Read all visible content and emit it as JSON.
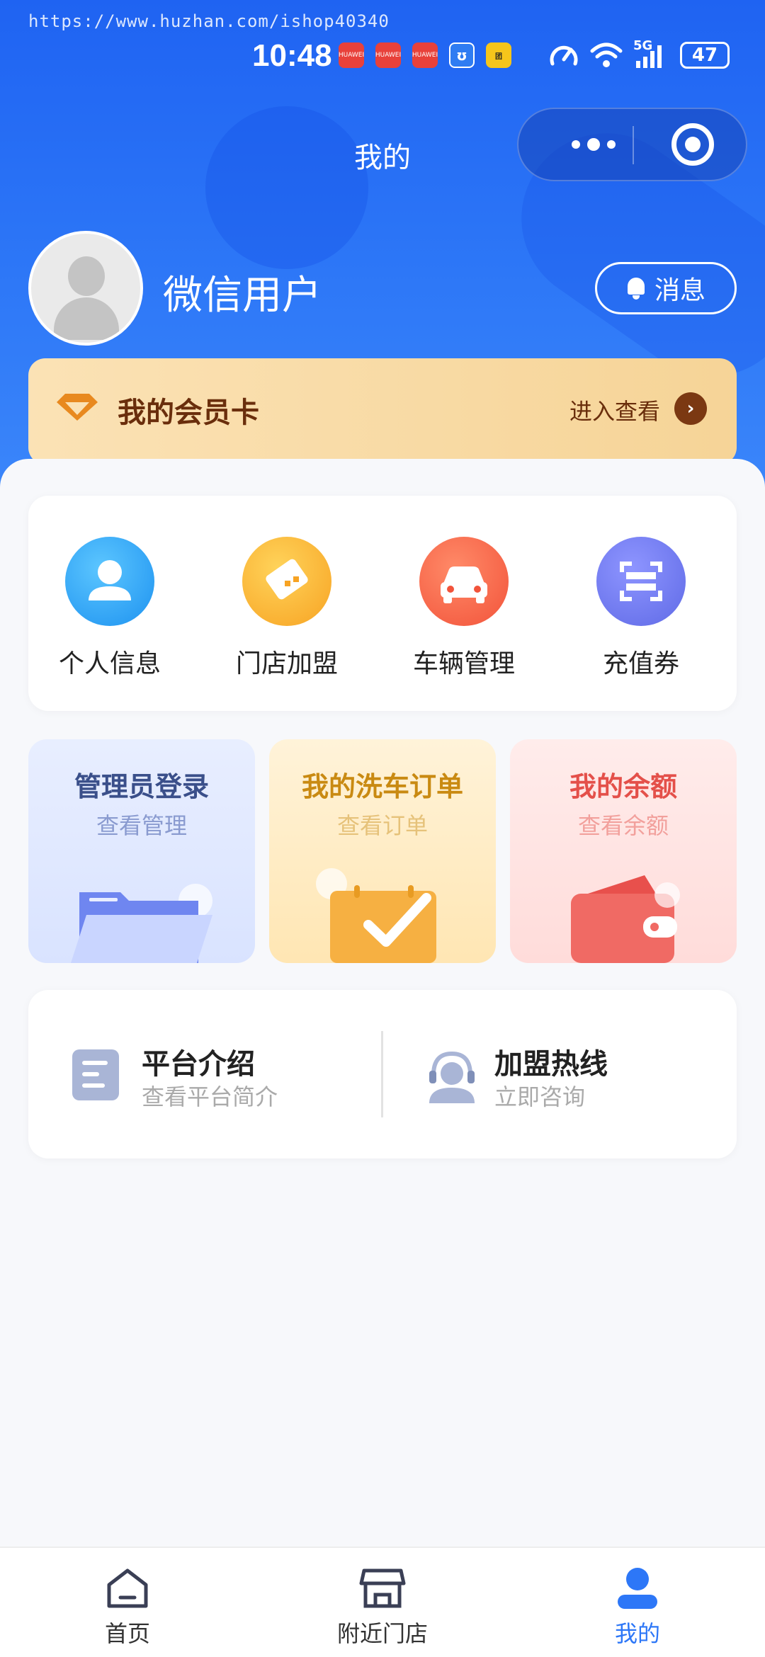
{
  "watermark": "https://www.huzhan.com/ishop40340",
  "status_bar": {
    "time": "10:48",
    "network": "5G",
    "battery": "47"
  },
  "nav": {
    "title": "我的"
  },
  "profile": {
    "username": "微信用户",
    "message_label": "消息"
  },
  "vip": {
    "title": "我的会员卡",
    "enter_label": "进入查看",
    "arrow": "›"
  },
  "quick_actions": [
    {
      "label": "个人信息",
      "icon": "person-icon",
      "color": "#1d92f0"
    },
    {
      "label": "门店加盟",
      "icon": "handshake-icon",
      "color": "#f7a323"
    },
    {
      "label": "车辆管理",
      "icon": "car-icon",
      "color": "#f2533a"
    },
    {
      "label": "充值券",
      "icon": "scan-icon",
      "color": "#5f6ae6"
    }
  ],
  "feature_cards": [
    {
      "title": "管理员登录",
      "subtitle": "查看管理",
      "icon": "folder-icon"
    },
    {
      "title": "我的洗车订单",
      "subtitle": "查看订单",
      "icon": "calendar-check-icon"
    },
    {
      "title": "我的余额",
      "subtitle": "查看余额",
      "icon": "wallet-icon"
    }
  ],
  "info": [
    {
      "title": "平台介绍",
      "subtitle": "查看平台简介",
      "icon": "document-icon"
    },
    {
      "title": "加盟热线",
      "subtitle": "立即咨询",
      "icon": "customer-service-icon"
    }
  ],
  "tabbar": [
    {
      "label": "首页",
      "icon": "home-icon",
      "active": false
    },
    {
      "label": "附近门店",
      "icon": "store-icon",
      "active": false
    },
    {
      "label": "我的",
      "icon": "user-icon",
      "active": true
    }
  ],
  "colors": {
    "primary": "#2d77f7",
    "vip_text": "#6a2e0c"
  }
}
